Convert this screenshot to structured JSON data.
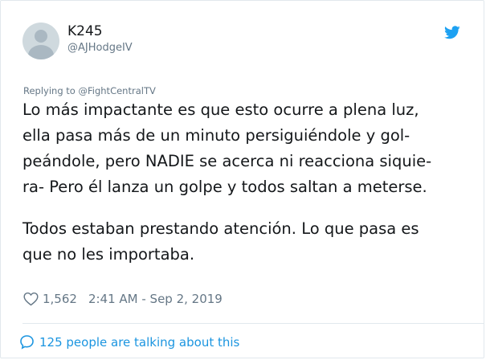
{
  "user": {
    "name": "K245",
    "handle": "@AJHodgeIV"
  },
  "reply": {
    "prefix": "Replying to",
    "to": "@FightCentralTV"
  },
  "tweet": {
    "lines": [
      "Lo más impactante es que esto ocurre a plena luz,",
      "ella pasa más de un minuto persiguiéndole y gol-",
      "peándole, pero NADIE se acerca ni reacciona siquie-",
      "ra- Pero él lanza un golpe y todos saltan a meterse."
    ],
    "lines2": [
      "Todos estaban prestando atención. Lo que pasa es",
      "que no les importaba."
    ]
  },
  "meta": {
    "likes": "1,562",
    "timestamp": "2:41 AM - Sep 2, 2019"
  },
  "footer": {
    "talking": "125 people are talking about this"
  },
  "colors": {
    "twitter_blue": "#1da1f2",
    "link_blue": "#1b95e0",
    "secondary_text": "#657786"
  },
  "icons": [
    "avatar",
    "twitter-bird-icon",
    "heart-icon",
    "speech-bubble-icon"
  ]
}
